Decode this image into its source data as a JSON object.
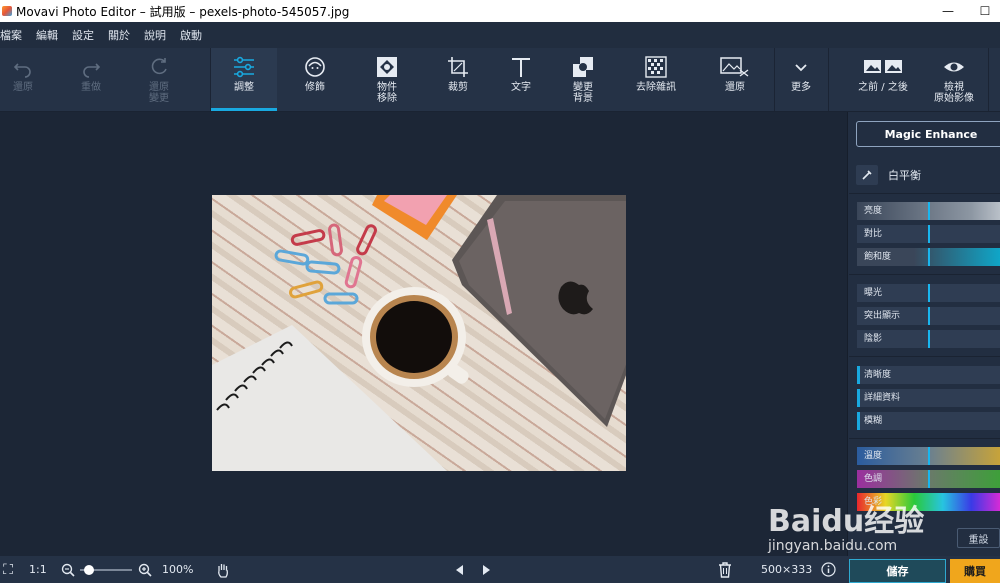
{
  "window": {
    "title": "Movavi Photo Editor – 試用版 – pexels-photo-545057.jpg",
    "minimize": "—",
    "maximize": "☐"
  },
  "menu": [
    "檔案",
    "編輯",
    "設定",
    "關於",
    "說明",
    "啟動"
  ],
  "toolbar": {
    "undo": "還原",
    "redo": "重做",
    "reset_line1": "還原",
    "reset_line2": "變更",
    "adjust": "調整",
    "retouch": "修飾",
    "object_line1": "物件",
    "object_line2": "移除",
    "crop": "裁剪",
    "text": "文字",
    "bg_line1": "變更",
    "bg_line2": "背景",
    "denoise": "去除雜訊",
    "restore": "還原",
    "more": "更多",
    "before_after": "之前 / 之後",
    "view_original_line1": "檢視",
    "view_original_line2": "原始影像"
  },
  "panel": {
    "magic_enhance": "Magic Enhance",
    "white_balance": "白平衡",
    "sliders_group1": [
      "亮度",
      "對比",
      "飽和度"
    ],
    "sliders_group2": [
      "曝光",
      "突出顯示",
      "陰影"
    ],
    "sliders_group3": [
      "清晰度",
      "詳細資料",
      "模糊"
    ],
    "sliders_group4": [
      "溫度",
      "色調",
      "色彩"
    ],
    "reset": "重設"
  },
  "statusbar": {
    "fit": "⛶",
    "one_to_one": "1:1",
    "zoom": "100%",
    "dimensions": "500×333",
    "save": "儲存",
    "buy": "購買"
  },
  "watermark": {
    "logo": "Baidu经验",
    "url": "jingyan.baidu.com"
  },
  "colors": {
    "accent": "#19a9e0",
    "buy": "#f0a61c",
    "background": "#1c2636",
    "toolbar": "#253246"
  }
}
